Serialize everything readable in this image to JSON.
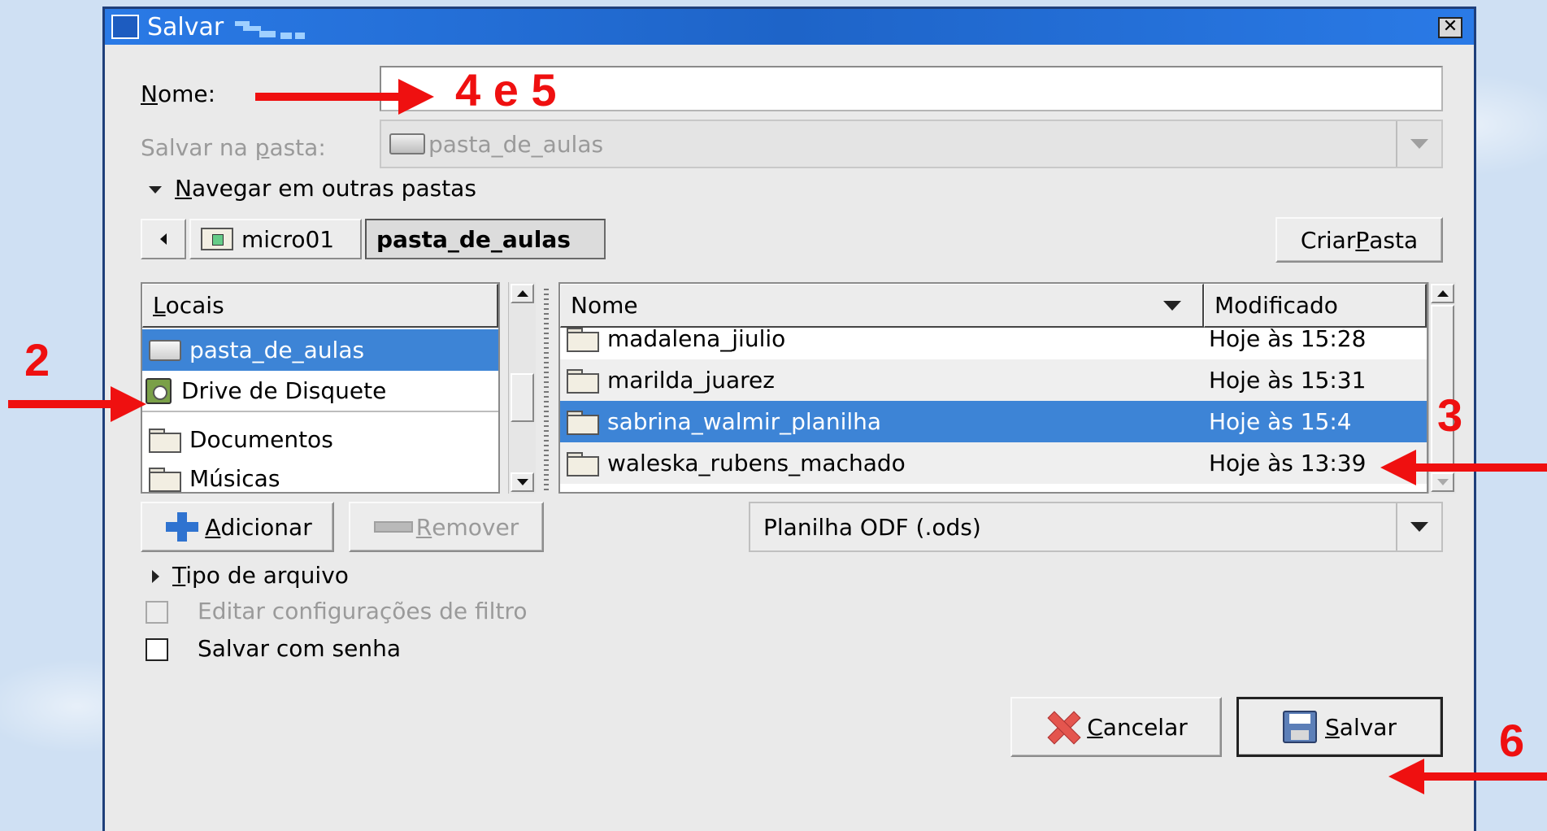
{
  "dialog": {
    "title": "Salvar",
    "close_glyph": "✕"
  },
  "name_field": {
    "label_u": "N",
    "label_rest": "ome:",
    "value": ""
  },
  "save_in": {
    "label_pre": "Salvar na ",
    "label_u": "p",
    "label_post": "asta:",
    "value": "pasta_de_aulas"
  },
  "browse": {
    "label_u": "N",
    "label_rest": "avegar em outras pastas",
    "expanded": true
  },
  "path_bar": {
    "segments": [
      "micro01",
      "pasta_de_aulas"
    ],
    "active": "pasta_de_aulas"
  },
  "create_folder": {
    "label_pre": "Criar ",
    "label_u": "P",
    "label_post": "asta"
  },
  "places": {
    "header_u": "L",
    "header_rest": "ocais",
    "items": [
      {
        "label": "pasta_de_aulas",
        "icon": "drive-icon",
        "selected": true
      },
      {
        "label": "Drive de Disquete",
        "icon": "floppy-icon",
        "selected": false
      },
      {
        "label": "Documentos",
        "icon": "folder-icon",
        "selected": false
      },
      {
        "label": "Músicas",
        "icon": "folder-icon",
        "selected": false
      }
    ]
  },
  "files": {
    "col_name": "Nome",
    "col_modified": "Modificado",
    "sort": "descending",
    "rows": [
      {
        "name": "madalena_jiulio",
        "modified": "Hoje às 15:28",
        "selected": false
      },
      {
        "name": "marilda_juarez",
        "modified": "Hoje às 15:31",
        "selected": false
      },
      {
        "name": "sabrina_walmir_planilha",
        "modified": "Hoje às 15:4",
        "selected": true
      },
      {
        "name": "waleska_rubens_machado",
        "modified": "Hoje às 13:39",
        "selected": false
      }
    ]
  },
  "add_button": {
    "label_u": "A",
    "label_rest": "dicionar"
  },
  "remove_button": {
    "label_u": "R",
    "label_rest": "emover"
  },
  "filter": {
    "value": "Planilha ODF (.ods)"
  },
  "file_type_expander": {
    "label_u": "T",
    "label_rest": "ipo de arquivo",
    "expanded": false
  },
  "options": {
    "edit_filter": {
      "label": "Editar configurações de filtro",
      "checked": false,
      "enabled": false
    },
    "save_password": {
      "label": "Salvar com senha",
      "checked": false,
      "enabled": true
    }
  },
  "cancel_button": {
    "label_u": "C",
    "label_rest": "ancelar"
  },
  "save_button": {
    "label_u": "S",
    "label_rest": "alvar"
  },
  "annotations": {
    "step_2": "2",
    "step_3": "3",
    "step_4_5": "4 e 5",
    "step_6": "6",
    "color": "#ef1010"
  },
  "colors": {
    "titlebar": "#1e64c8",
    "selection": "#3d84d6",
    "dialog_bg": "#eaeaea"
  }
}
